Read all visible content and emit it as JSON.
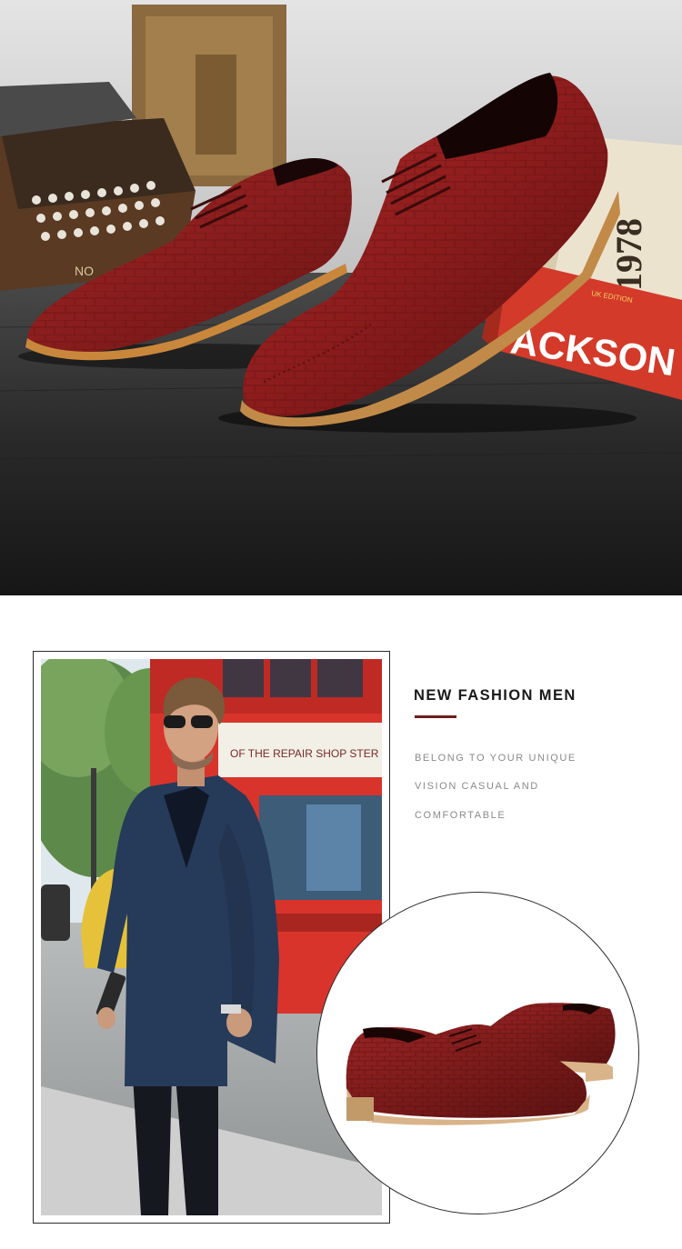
{
  "hero": {
    "book_year": "1978",
    "book_spine_text": "ACKSON",
    "book_edition": "UK EDITION",
    "typewriter_brand": "NO"
  },
  "photo": {
    "bus_sign": "OF THE REPAIR SHOP STER"
  },
  "copy": {
    "headline": "NEW FASHION MEN",
    "lines": [
      "BELONG TO YOUR UNIQUE",
      "VISION CASUAL AND",
      "COMFORTABLE"
    ]
  },
  "colors": {
    "accent": "#6b1d1d",
    "shoe_red": "#8c1c1c",
    "bus_red": "#d8342c"
  }
}
